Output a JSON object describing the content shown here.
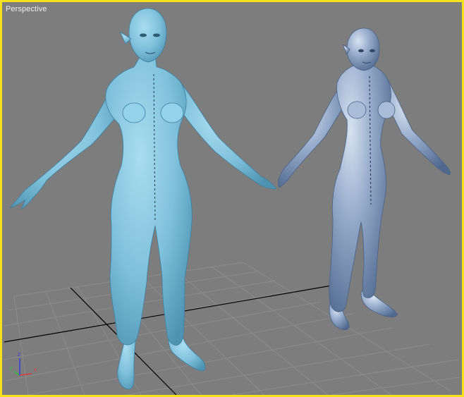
{
  "viewport": {
    "label": "Perspective",
    "border_color": "#f5e21a",
    "background_color": "#7d7d7d",
    "grid_color": "#8c8c8c",
    "grid_center_color": "#000000"
  },
  "scene_objects": [
    {
      "name": "female-body-model-smooth",
      "color": "#7fc1db"
    },
    {
      "name": "female-body-model-shaded",
      "color": "#93a9c9"
    }
  ],
  "axis_gizmo": {
    "x": "x",
    "y": "y",
    "z": "z",
    "x_color": "#e03a3a",
    "y_color": "#2fbf3a",
    "z_color": "#3a3ae0"
  }
}
